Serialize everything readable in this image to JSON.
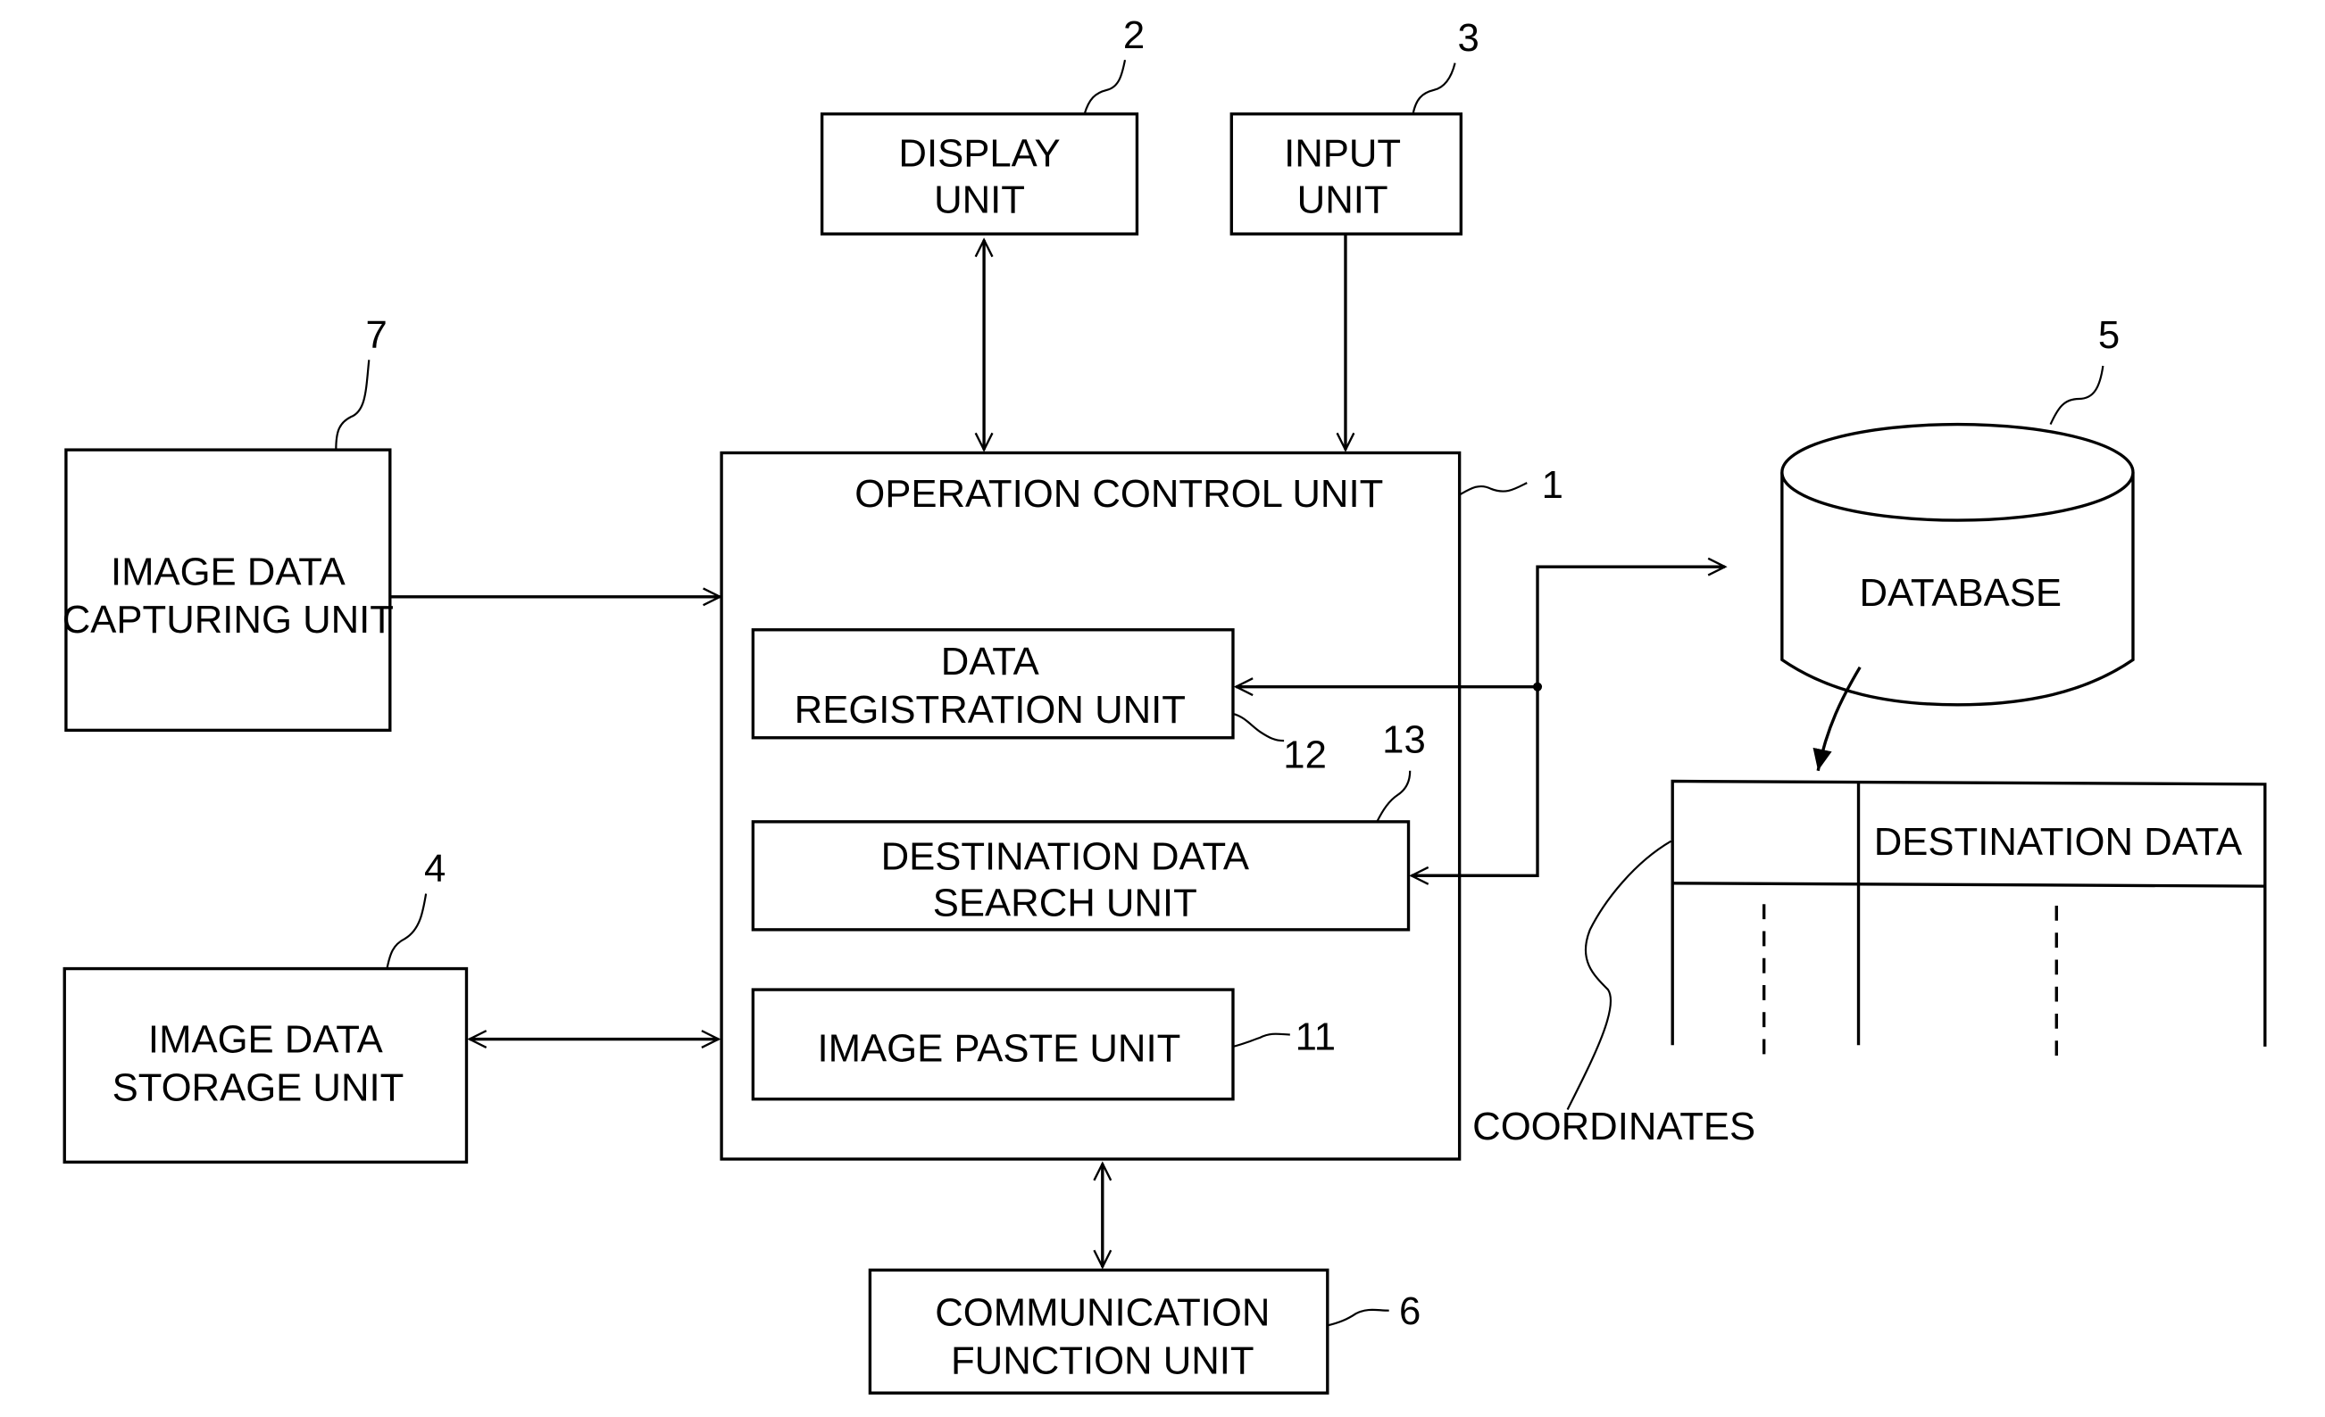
{
  "diagram": {
    "blocks": {
      "display": {
        "ref": "2",
        "line1": "DISPLAY",
        "line2": "UNIT"
      },
      "input": {
        "ref": "3",
        "line1": "INPUT",
        "line2": "UNIT"
      },
      "capture": {
        "ref": "7",
        "line1": "IMAGE DATA",
        "line2": "CAPTURING UNIT"
      },
      "storage": {
        "ref": "4",
        "line1": "IMAGE DATA",
        "line2": "STORAGE UNIT"
      },
      "control": {
        "ref": "1",
        "label": "OPERATION CONTROL UNIT"
      },
      "registration": {
        "ref": "12",
        "line1": "DATA",
        "line2": "REGISTRATION UNIT"
      },
      "search": {
        "ref": "13",
        "line1": "DESTINATION DATA",
        "line2": "SEARCH UNIT"
      },
      "paste": {
        "ref": "11",
        "label": "IMAGE PASTE UNIT"
      },
      "comm": {
        "ref": "6",
        "line1": "COMMUNICATION",
        "line2": "FUNCTION UNIT"
      },
      "database": {
        "ref": "5",
        "label": "DATABASE"
      }
    },
    "table": {
      "header_right": "DESTINATION DATA",
      "coordinates_label": "COORDINATES"
    }
  }
}
